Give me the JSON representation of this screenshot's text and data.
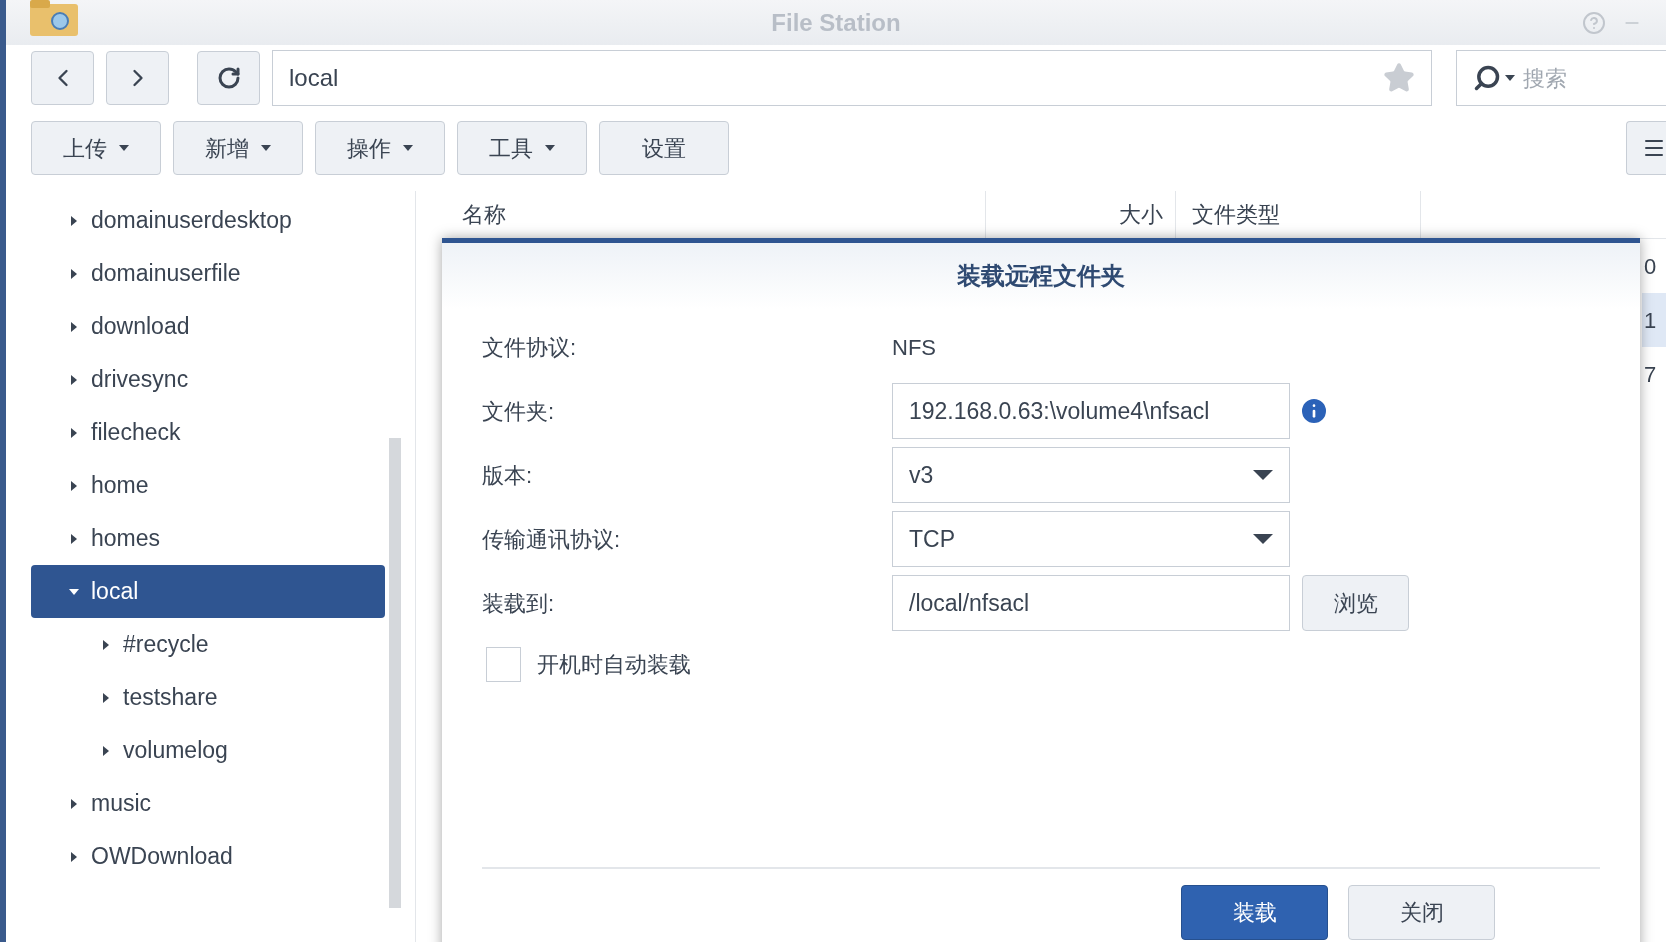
{
  "window": {
    "title": "File Station"
  },
  "path_field": {
    "value": "local",
    "favorite": false
  },
  "search": {
    "placeholder": "搜索"
  },
  "toolbar": [
    {
      "label": "上传",
      "has_menu": true
    },
    {
      "label": "新增",
      "has_menu": true
    },
    {
      "label": "操作",
      "has_menu": true
    },
    {
      "label": "工具",
      "has_menu": true
    },
    {
      "label": "设置",
      "has_menu": false
    }
  ],
  "tree": [
    {
      "label": "domainuserdesktop",
      "expanded": false,
      "selected": false
    },
    {
      "label": "domainuserfile",
      "expanded": false,
      "selected": false
    },
    {
      "label": "download",
      "expanded": false,
      "selected": false
    },
    {
      "label": "drivesync",
      "expanded": false,
      "selected": false
    },
    {
      "label": "filecheck",
      "expanded": false,
      "selected": false
    },
    {
      "label": "home",
      "expanded": false,
      "selected": false
    },
    {
      "label": "homes",
      "expanded": false,
      "selected": false
    },
    {
      "label": "local",
      "expanded": true,
      "selected": true,
      "children": [
        {
          "label": "#recycle",
          "expanded": false,
          "selected": false
        },
        {
          "label": "testshare",
          "expanded": false,
          "selected": false
        },
        {
          "label": "volumelog",
          "expanded": false,
          "selected": false
        }
      ]
    },
    {
      "label": "music",
      "expanded": false,
      "selected": false
    },
    {
      "label": "OWDownload",
      "expanded": false,
      "selected": false
    }
  ],
  "table": {
    "columns": [
      "名称",
      "大小",
      "文件类型"
    ],
    "rows": [
      {
        "column_3": "0",
        "selected": false
      },
      {
        "column_3": "1",
        "selected": true
      },
      {
        "column_3": "7",
        "selected": false
      }
    ]
  },
  "dialog": {
    "title": "装载远程文件夹",
    "fields": [
      {
        "kind": "text",
        "label": "文件协议:",
        "value": "NFS"
      },
      {
        "kind": "input",
        "label": "文件夹:",
        "value": "192.168.0.63:\\volume4\\nfsacl",
        "info": true
      },
      {
        "kind": "select",
        "label": "版本:",
        "value": "v3"
      },
      {
        "kind": "select",
        "label": "传输通讯协议:",
        "value": "TCP"
      },
      {
        "kind": "browse",
        "label": "装载到:",
        "value": "/local/nfsacl",
        "button": "浏览"
      }
    ],
    "checkbox": {
      "label": "开机时自动装载",
      "checked": false
    },
    "buttons": [
      {
        "label": "装载",
        "primary": true
      },
      {
        "label": "关闭",
        "primary": false
      }
    ]
  }
}
